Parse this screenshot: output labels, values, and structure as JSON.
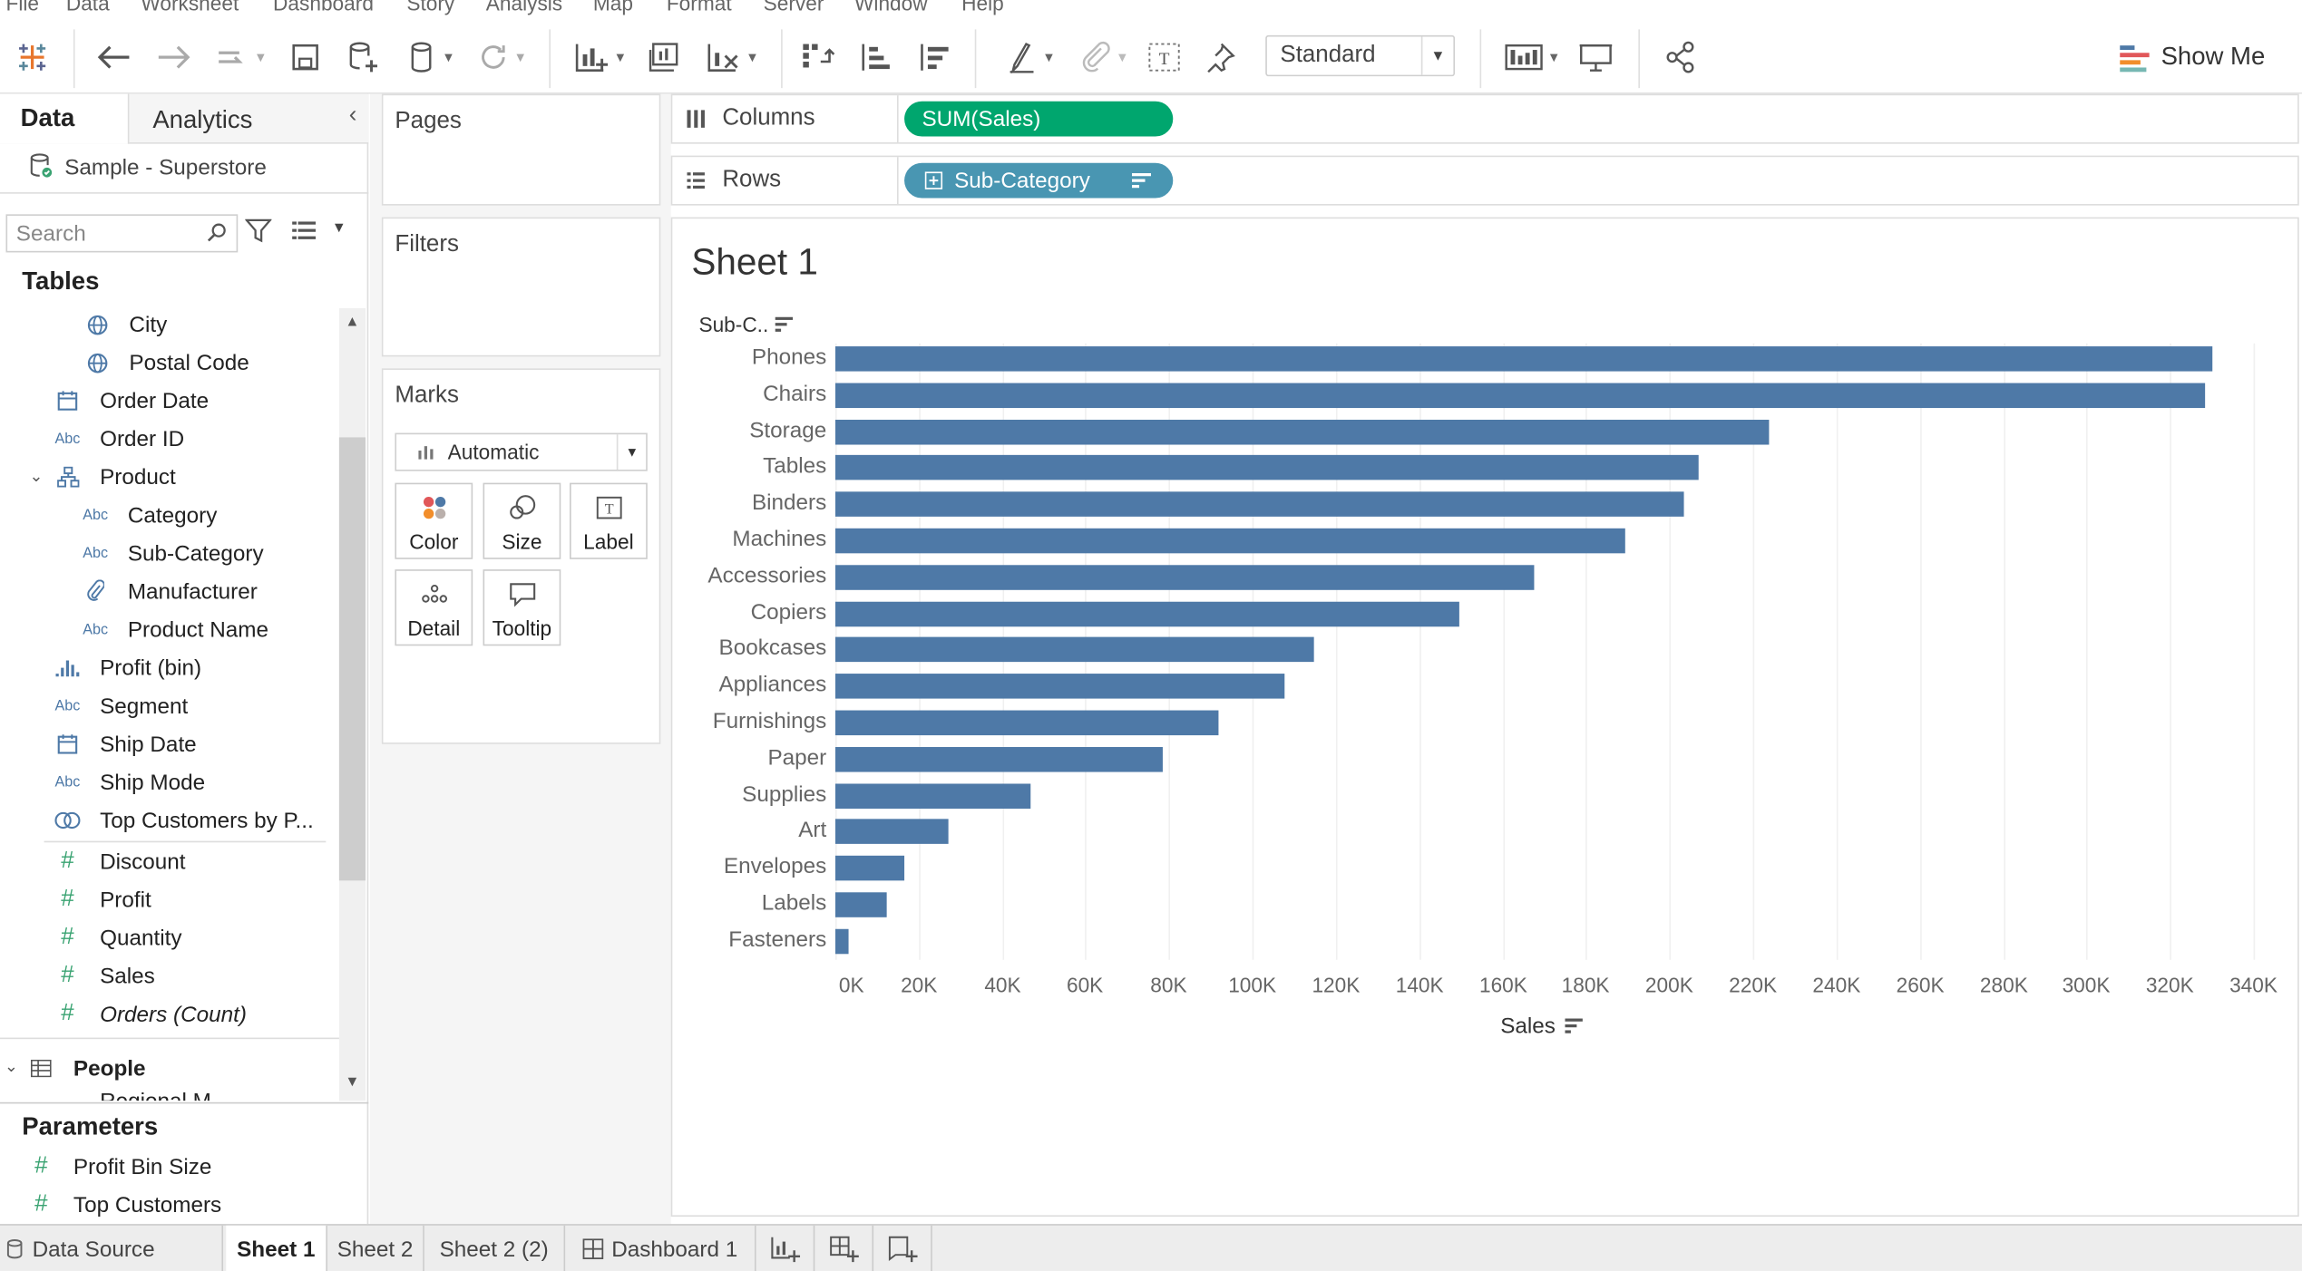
{
  "menu": [
    "File",
    "Data",
    "Worksheet",
    "Dashboard",
    "Story",
    "Analysis",
    "Map",
    "Format",
    "Server",
    "Window",
    "Help"
  ],
  "toolbar": {
    "fit": "Standard",
    "show_me": "Show Me"
  },
  "data_pane": {
    "tabs": {
      "data": "Data",
      "analytics": "Analytics"
    },
    "datasource": "Sample - Superstore",
    "search_placeholder": "Search",
    "tables_heading": "Tables",
    "fields": [
      {
        "name": "City",
        "type": "globe"
      },
      {
        "name": "Postal Code",
        "type": "globe"
      },
      {
        "name": "Order Date",
        "type": "date"
      },
      {
        "name": "Order ID",
        "type": "Abc"
      },
      {
        "name": "Product",
        "type": "hierarchy"
      },
      {
        "name": "Category",
        "type": "Abc"
      },
      {
        "name": "Sub-Category",
        "type": "Abc"
      },
      {
        "name": "Manufacturer",
        "type": "clip"
      },
      {
        "name": "Product Name",
        "type": "Abc"
      },
      {
        "name": "Profit (bin)",
        "type": "bin"
      },
      {
        "name": "Segment",
        "type": "Abc"
      },
      {
        "name": "Ship Date",
        "type": "date"
      },
      {
        "name": "Ship Mode",
        "type": "Abc"
      },
      {
        "name": "Top Customers by P...",
        "type": "set"
      },
      {
        "name": "Discount",
        "type": "#"
      },
      {
        "name": "Profit",
        "type": "#"
      },
      {
        "name": "Quantity",
        "type": "#"
      },
      {
        "name": "Sales",
        "type": "#"
      },
      {
        "name": "Orders (Count)",
        "type": "#"
      }
    ],
    "people_table": "People",
    "people_partial": "Regional M...",
    "parameters_heading": "Parameters",
    "parameters": [
      "Profit Bin Size",
      "Top Customers"
    ]
  },
  "cards": {
    "pages": "Pages",
    "filters": "Filters",
    "marks": "Marks",
    "mark_type": "Automatic",
    "mark_buttons": [
      "Color",
      "Size",
      "Label",
      "Detail",
      "Tooltip"
    ]
  },
  "shelves": {
    "columns_label": "Columns",
    "columns_pill": "SUM(Sales)",
    "rows_label": "Rows",
    "rows_pill": "Sub-Category"
  },
  "viz": {
    "sheet_title": "Sheet 1",
    "row_header": "Sub-C..",
    "x_axis_label": "Sales"
  },
  "chart_data": {
    "type": "bar",
    "orientation": "horizontal",
    "title": "Sheet 1",
    "xlabel": "Sales",
    "ylabel": "Sub-C..",
    "categories": [
      "Phones",
      "Chairs",
      "Storage",
      "Tables",
      "Binders",
      "Machines",
      "Accessories",
      "Copiers",
      "Bookcases",
      "Appliances",
      "Furnishings",
      "Paper",
      "Supplies",
      "Art",
      "Envelopes",
      "Labels",
      "Fasteners"
    ],
    "values": [
      330007,
      328449,
      223844,
      206966,
      203413,
      189239,
      167380,
      149528,
      114880,
      107532,
      91705,
      78479,
      46674,
      27119,
      16476,
      12486,
      3024
    ],
    "xlim": [
      0,
      340000
    ],
    "ticks": [
      "0K",
      "20K",
      "40K",
      "60K",
      "80K",
      "100K",
      "120K",
      "140K",
      "160K",
      "180K",
      "200K",
      "220K",
      "240K",
      "260K",
      "280K",
      "300K",
      "320K",
      "340K"
    ],
    "tick_values": [
      0,
      20000,
      40000,
      60000,
      80000,
      100000,
      120000,
      140000,
      160000,
      180000,
      200000,
      220000,
      240000,
      260000,
      280000,
      300000,
      320000,
      340000
    ],
    "bar_color": "#4e79a7",
    "grid": true
  },
  "bottom_tabs": {
    "data_source": "Data Source",
    "sheets": [
      "Sheet 1",
      "Sheet 2",
      "Sheet 2 (2)",
      "Dashboard 1"
    ],
    "active": "Sheet 1"
  },
  "colors": {
    "columns_pill": "#00a66e",
    "rows_pill": "#4996b2",
    "measure_icon": "#3aa372",
    "dimension_icon": "#4e79a7"
  }
}
